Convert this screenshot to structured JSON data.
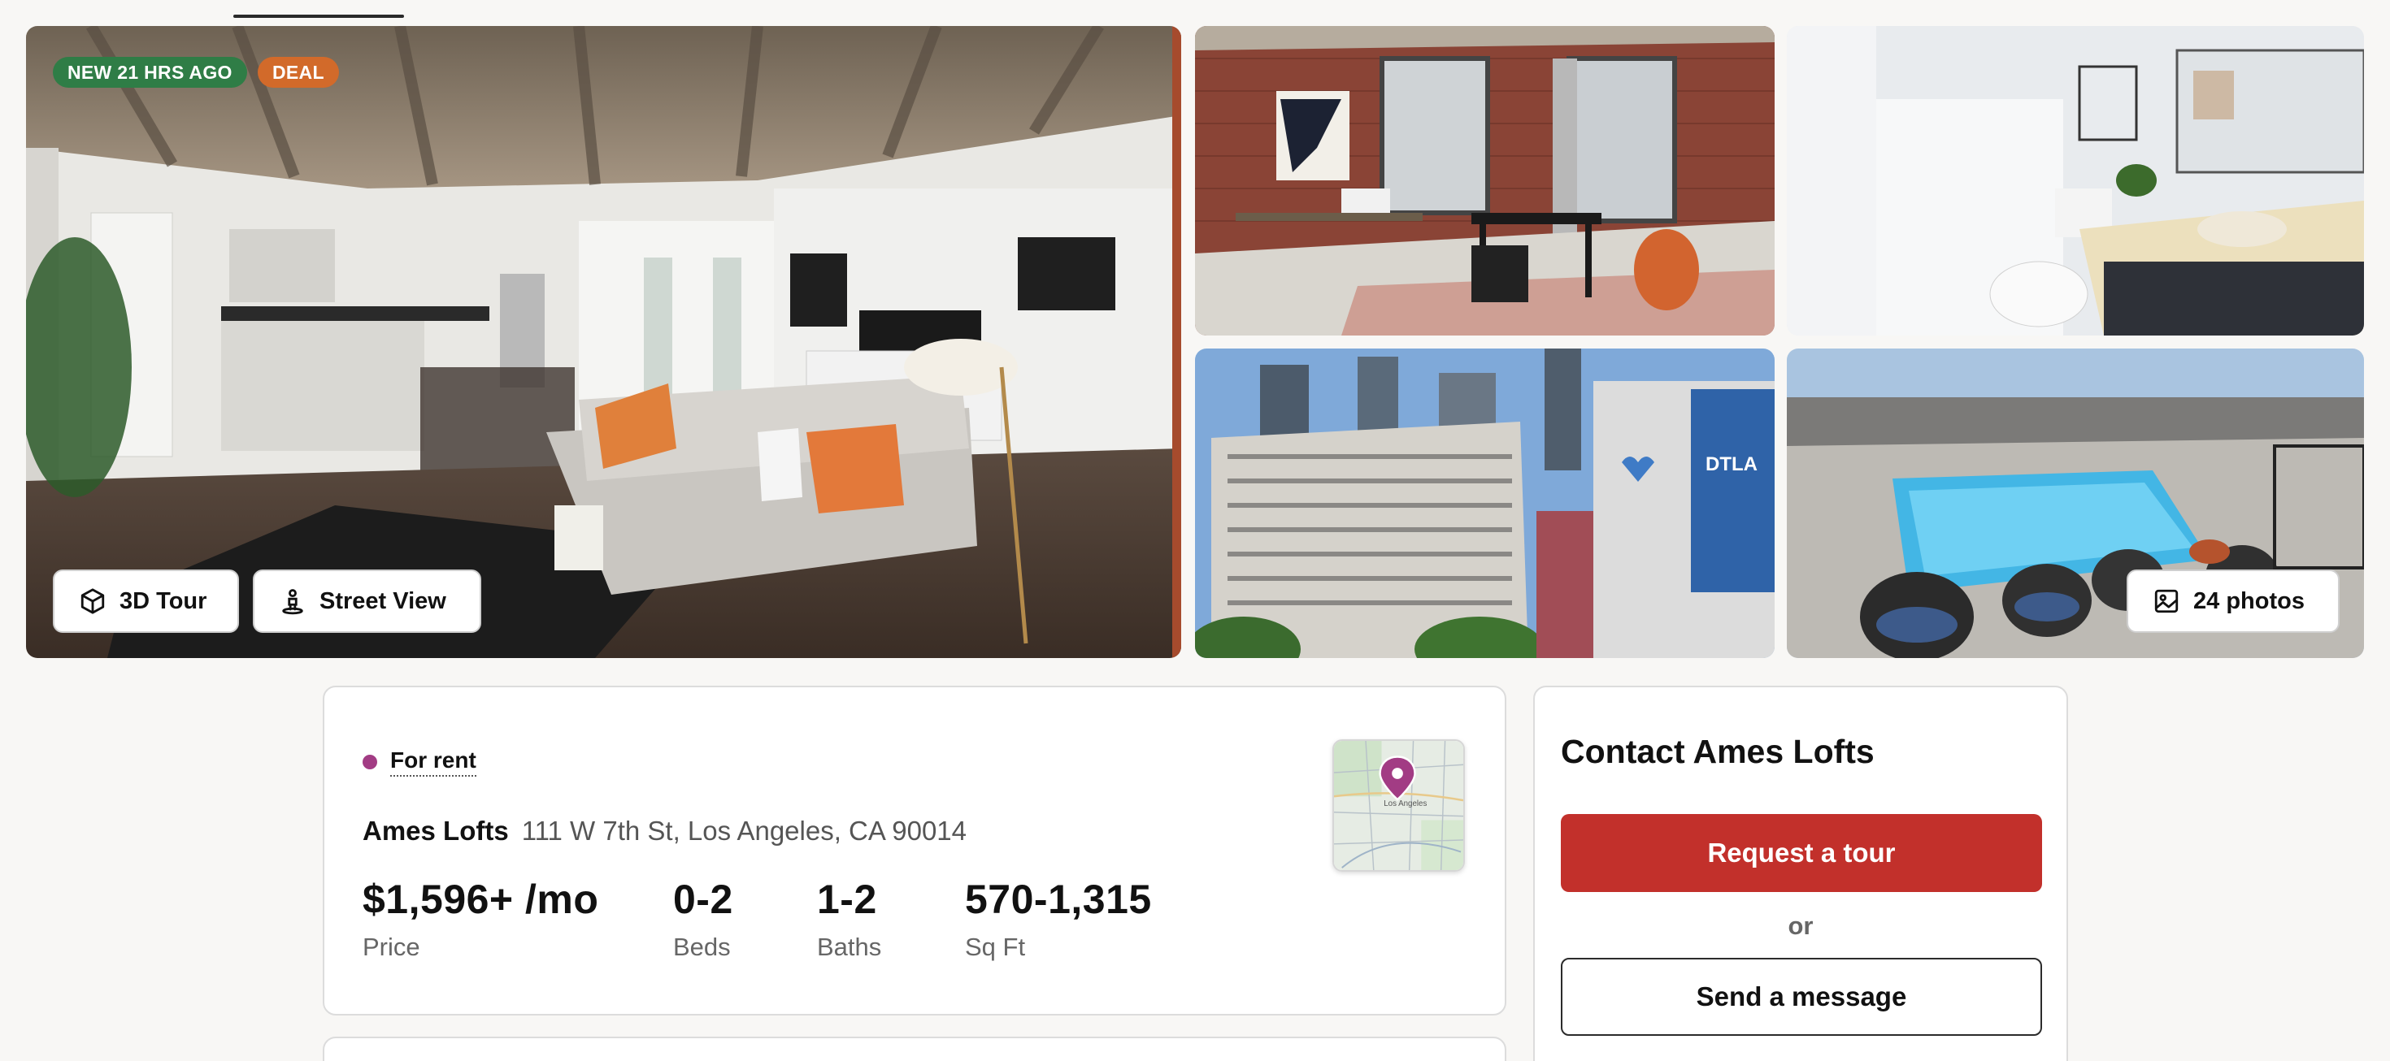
{
  "gallery": {
    "badges": {
      "new": "NEW 21 HRS AGO",
      "deal": "DEAL"
    },
    "buttons": {
      "tour_3d": "3D Tour",
      "street_view": "Street View",
      "photos": "24 photos"
    },
    "mural_text": "DTLA"
  },
  "map": {
    "city_label": "Los Angeles"
  },
  "listing": {
    "status": "For rent",
    "name": "Ames Lofts",
    "address": "111 W 7th St,  Los Angeles, CA 90014",
    "stats": [
      {
        "value": "$1,596+ /mo",
        "label": "Price"
      },
      {
        "value": "0-2",
        "label": "Beds"
      },
      {
        "value": "1-2",
        "label": "Baths"
      },
      {
        "value": "570-1,315",
        "label": "Sq Ft"
      }
    ]
  },
  "contact": {
    "title": "Contact Ames Lofts",
    "request_tour": "Request a tour",
    "or": "or",
    "send_message": "Send a message"
  },
  "colors": {
    "brand_red": "#c2302b",
    "new_badge": "#2f7d46",
    "deal_badge": "#d26a2a",
    "status_dot": "#a23c84"
  }
}
